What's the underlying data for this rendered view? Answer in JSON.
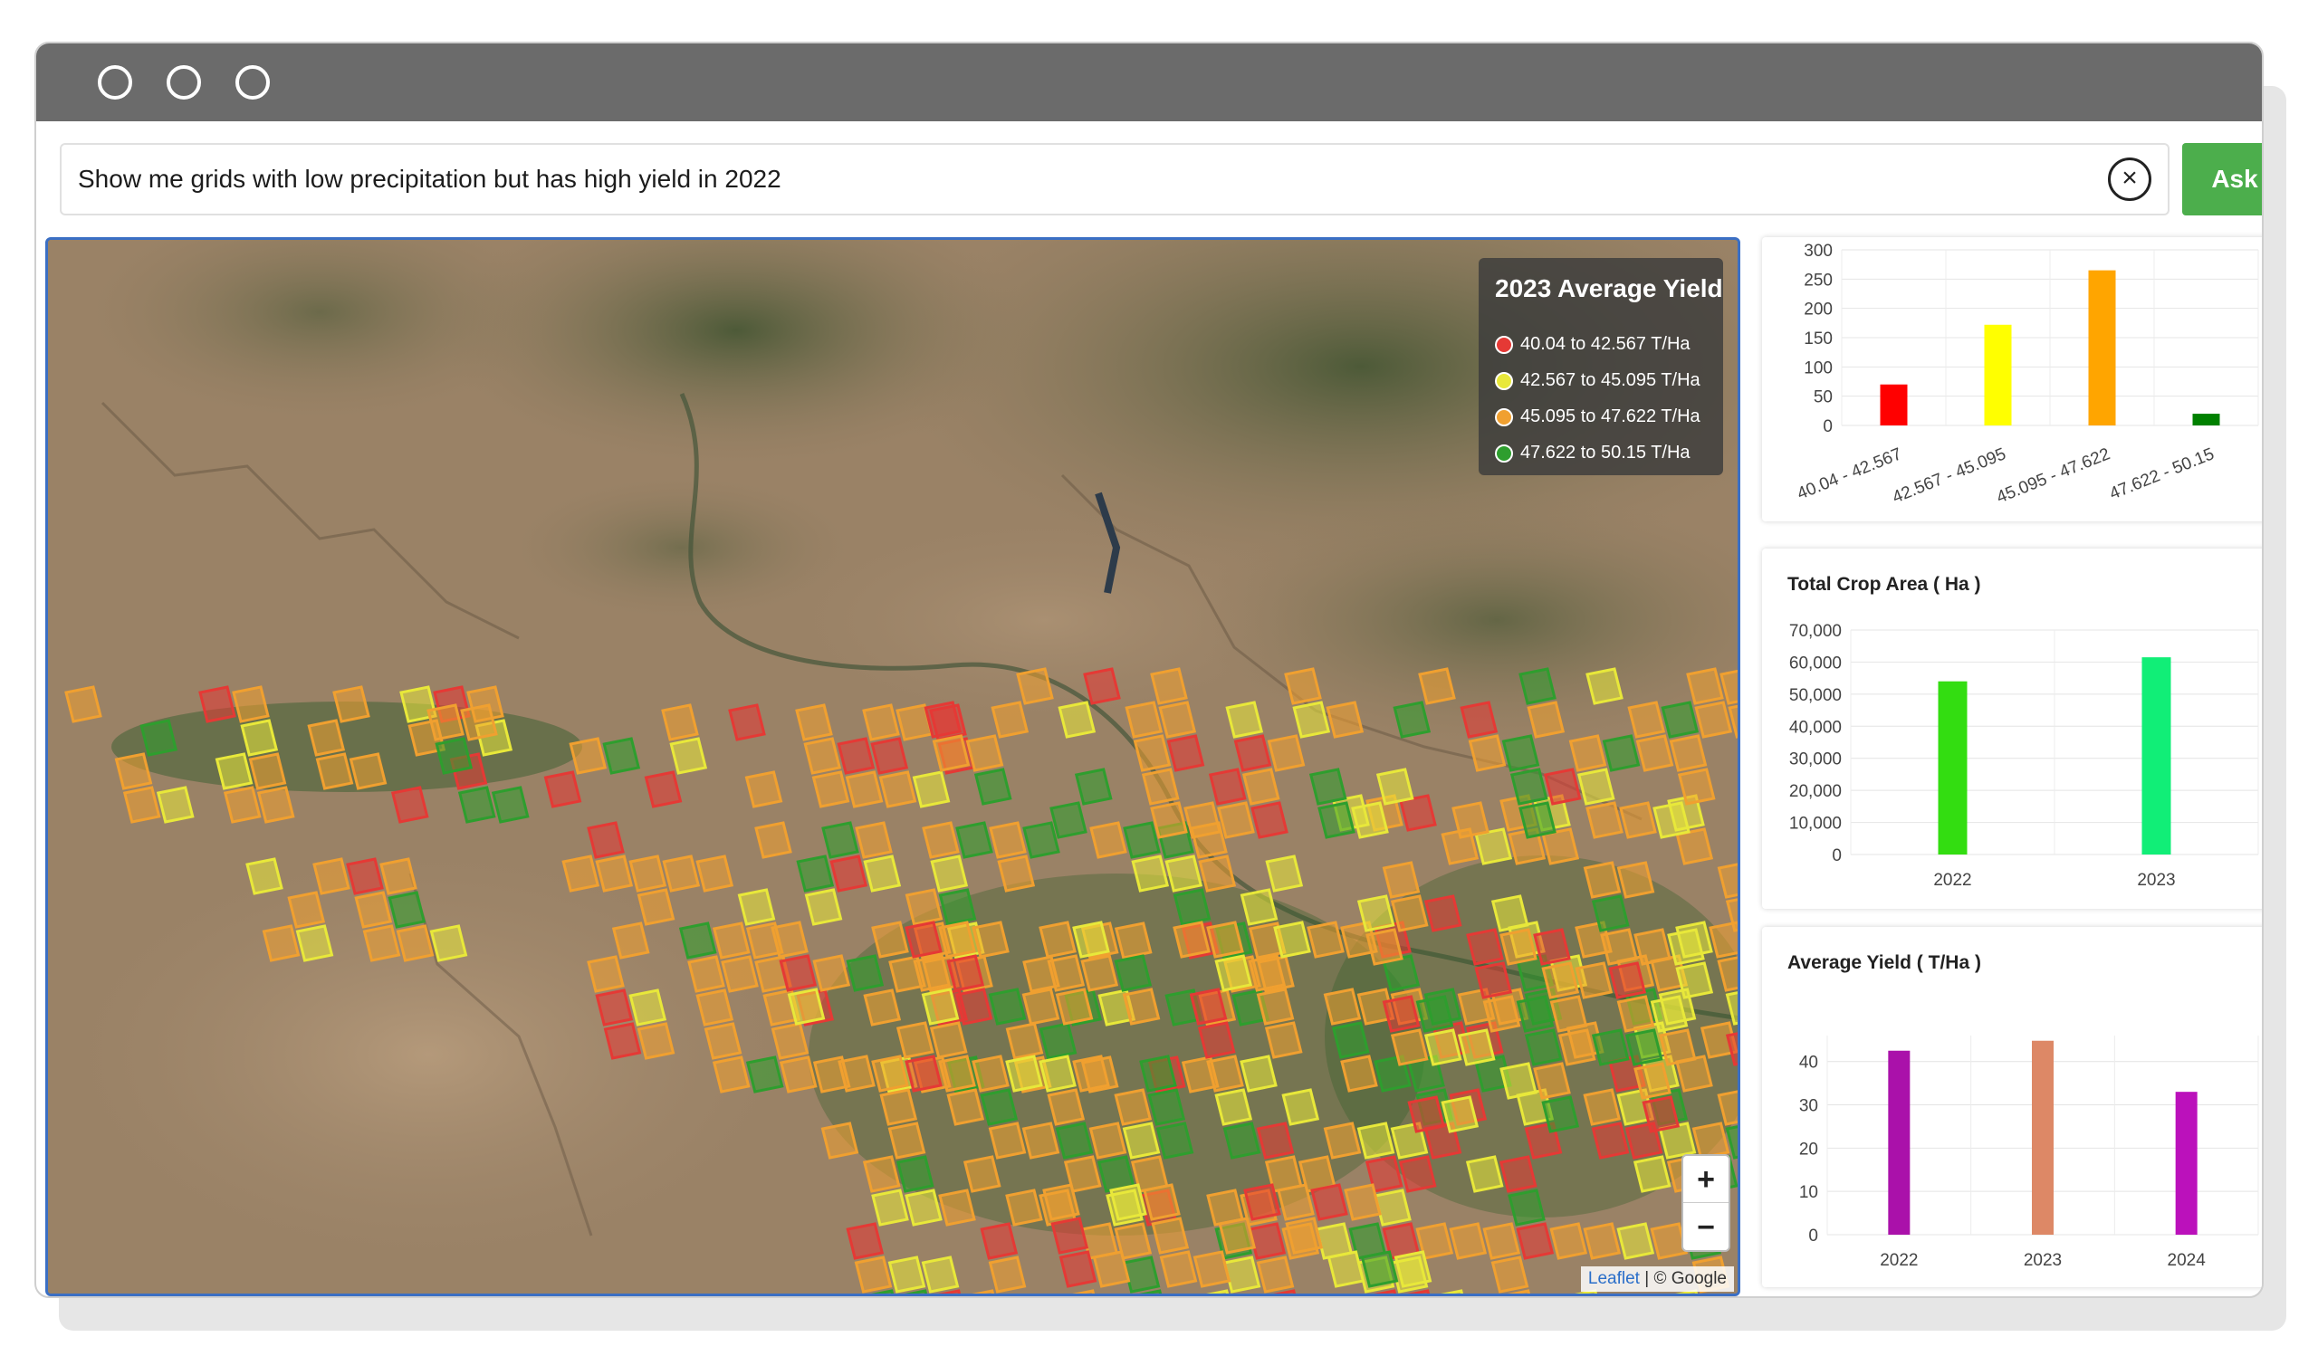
{
  "window": {
    "controls": [
      "circle",
      "circle",
      "circle"
    ]
  },
  "query": {
    "value": "Show me grids with low precipitation but has high yield in 2022",
    "clear_icon": "x-circle-icon",
    "ask_label": "Ask"
  },
  "map": {
    "legend": {
      "title": "2023 Average Yield",
      "items": [
        {
          "label": "40.04 to 42.567 T/Ha",
          "color": "#e53935"
        },
        {
          "label": "42.567 to 45.095 T/Ha",
          "color": "#e8e83a"
        },
        {
          "label": "45.095 to 47.622 T/Ha",
          "color": "#f0a030"
        },
        {
          "label": "47.622 to 50.15 T/Ha",
          "color": "#2e9e2e"
        }
      ]
    },
    "zoom_in": "+",
    "zoom_out": "−",
    "attribution": {
      "leaflet": "Leaflet",
      "separator": " | © Google"
    }
  },
  "chart_data": [
    {
      "type": "bar",
      "title": "",
      "categories": [
        "40.04 - 42.567",
        "42.567 - 45.095",
        "45.095 - 47.622",
        "47.622 - 50.15"
      ],
      "values": [
        70,
        172,
        265,
        20
      ],
      "colors": [
        "#ff0000",
        "#ffff00",
        "#ffa500",
        "#008000"
      ],
      "ylim": [
        0,
        300
      ],
      "yticks": [
        "300",
        "250",
        "200",
        "150",
        "100",
        "50",
        "0"
      ]
    },
    {
      "type": "bar",
      "title": "Total Crop Area ( Ha )",
      "categories": [
        "2022",
        "2023"
      ],
      "values": [
        54000,
        61500
      ],
      "colors": [
        "#33dd11",
        "#11ee77"
      ],
      "ylim": [
        0,
        70000
      ],
      "yticks": [
        "70,000",
        "60,000",
        "50,000",
        "40,000",
        "30,000",
        "20,000",
        "10,000",
        "0"
      ]
    },
    {
      "type": "bar",
      "title": "Average Yield ( T/Ha )",
      "categories": [
        "2022",
        "2023",
        "2024"
      ],
      "values": [
        42.5,
        44.8,
        33
      ],
      "colors": [
        "#aa11aa",
        "#dd8866",
        "#bb11bb"
      ],
      "ylim": [
        0,
        46
      ],
      "yticks": [
        "40",
        "30",
        "20",
        "10",
        "0"
      ]
    }
  ]
}
